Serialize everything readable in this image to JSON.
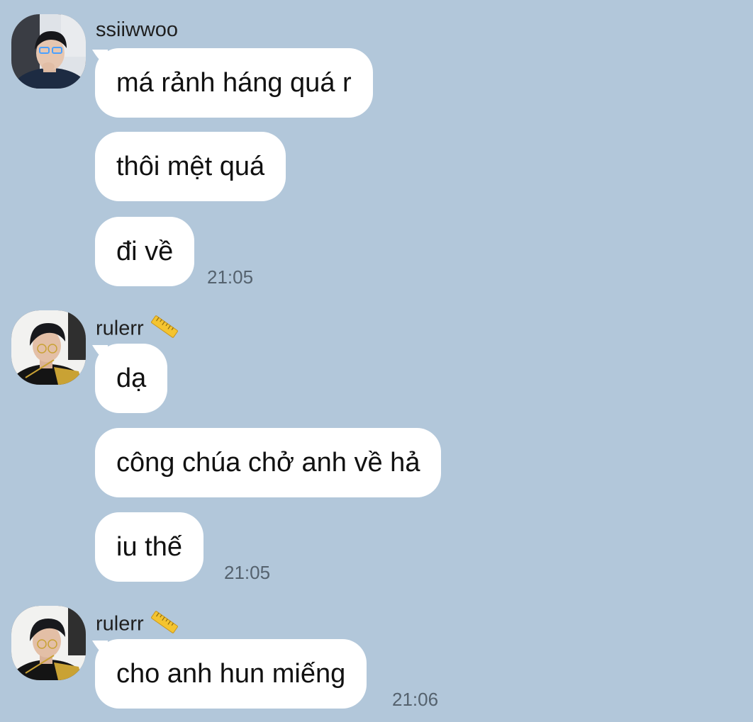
{
  "chat": {
    "groups": [
      {
        "sender": "ssiiwwoo",
        "avatar": "ssiiwwoo-avatar",
        "badge": "",
        "messages": [
          "má rảnh háng quá r",
          "thôi mệt quá",
          "đi về"
        ],
        "time": "21:05"
      },
      {
        "sender": "rulerr",
        "avatar": "rulerr-avatar",
        "badge": "straight-ruler-icon",
        "messages": [
          "dạ",
          "công chúa chở anh về hả",
          "iu thế"
        ],
        "time": "21:05"
      },
      {
        "sender": "rulerr",
        "avatar": "rulerr-avatar",
        "badge": "straight-ruler-icon",
        "messages": [
          "cho anh hun miếng"
        ],
        "time": "21:06"
      }
    ]
  },
  "colors": {
    "background": "#b2c7da",
    "bubble": "#ffffff",
    "timestamp": "#55626e",
    "ruler": "#f4c430"
  }
}
